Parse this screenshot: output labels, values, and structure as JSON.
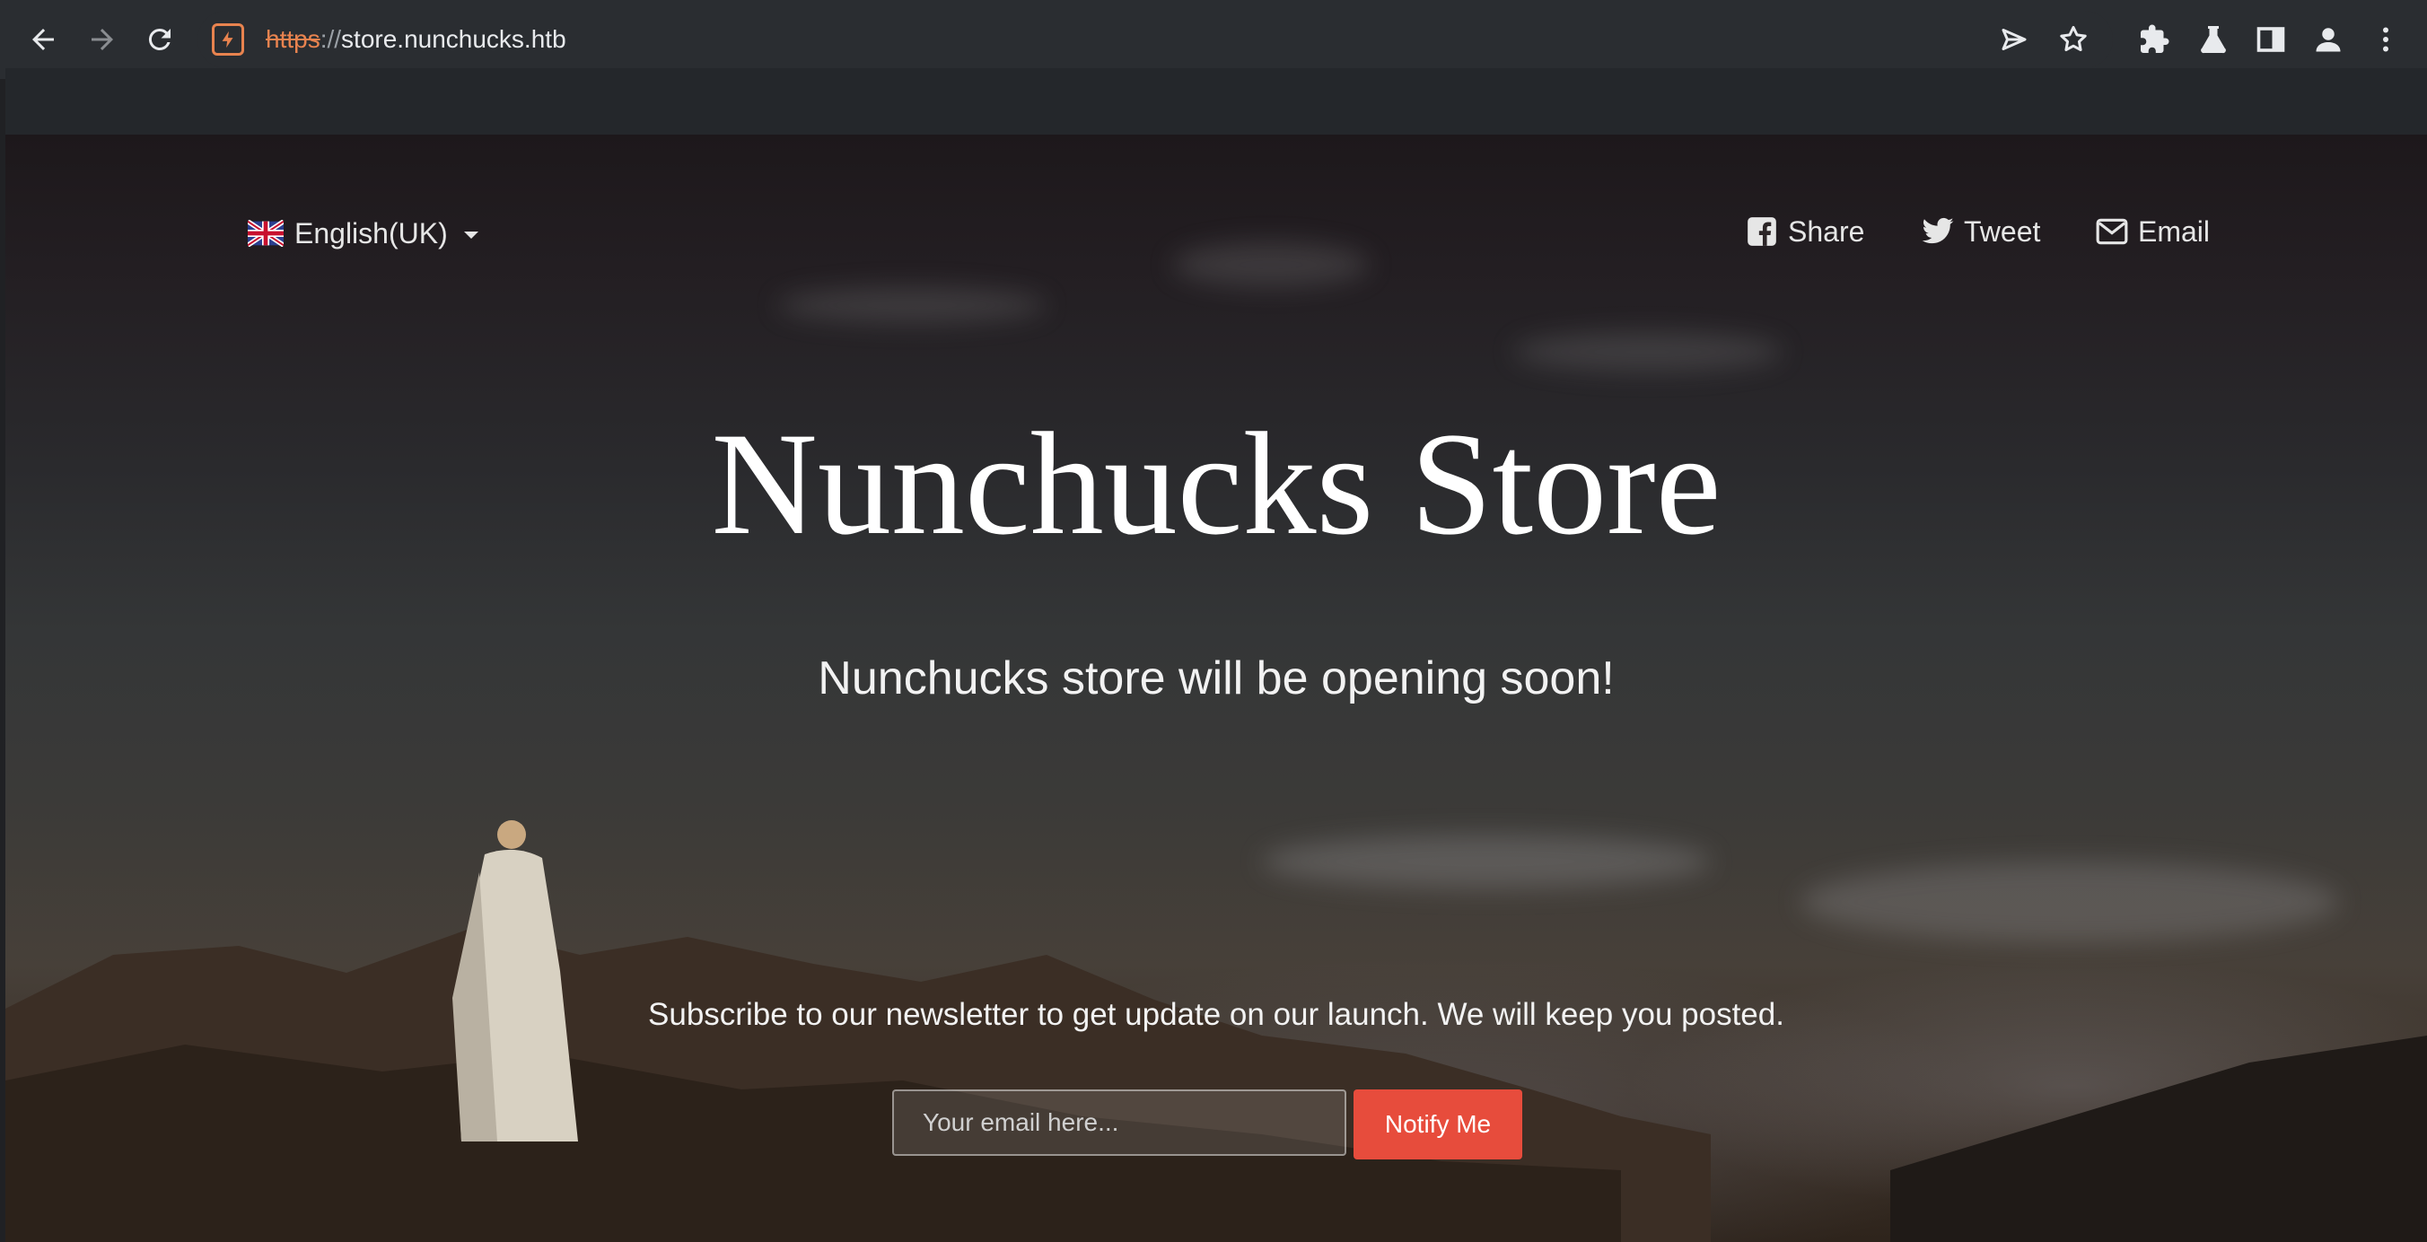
{
  "browser": {
    "url_scheme": "https",
    "url_separator": "://",
    "url_host": "store.nunchucks.htb",
    "icons": {
      "back": "back-arrow-icon",
      "forward": "forward-arrow-icon",
      "reload": "reload-icon",
      "site_info": "site-info-icon",
      "send": "send-icon",
      "bookmark": "bookmark-star-icon",
      "extensions": "extensions-icon",
      "labs": "labs-flask-icon",
      "side_panel": "side-panel-icon",
      "profile": "profile-icon",
      "menu": "more-menu-icon"
    },
    "colors": {
      "insecure_scheme": "#e8834f",
      "frame": "#202124"
    }
  },
  "page": {
    "language": {
      "label": "English(UK)",
      "flag_icon": "uk-flag-icon"
    },
    "share": [
      {
        "label": "Share",
        "icon": "facebook-icon"
      },
      {
        "label": "Tweet",
        "icon": "twitter-icon"
      },
      {
        "label": "Email",
        "icon": "envelope-icon"
      }
    ],
    "title": "Nunchucks Store",
    "subtitle": "Nunchucks store will be opening soon!",
    "newsletter_text": "Subscribe to our newsletter to get update on our launch. We will keep you posted.",
    "email_placeholder": "Your email here...",
    "email_value": "",
    "notify_label": "Notify Me",
    "colors": {
      "accent": "#e74c3c",
      "text": "#ffffff"
    }
  }
}
